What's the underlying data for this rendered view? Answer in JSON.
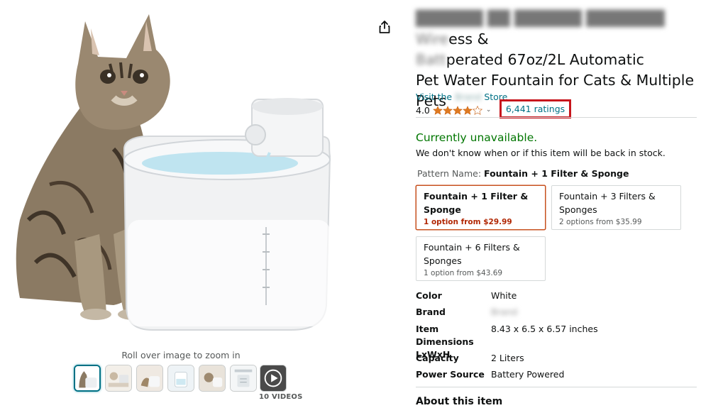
{
  "gallery": {
    "zoom_hint": "Roll over image to zoom in",
    "videos_label": "10 VIDEOS",
    "thumbnails": [
      "cat-and-fountain",
      "fountain-parts",
      "cat-drinking",
      "fountain-side",
      "cat-with-fountain",
      "fountain-diagram",
      "video-play"
    ]
  },
  "product": {
    "title_blurred_lead": "██████ ██ ██████ ███████",
    "title_blurred_word": "Wire",
    "title_visible_1": "ess &",
    "title_blur_2": "Batt",
    "title_visible_2": "perated 67oz/2L Automatic",
    "title_line_3": "Pet Water Fountain for Cats & Multiple",
    "title_line_4": "Pets",
    "store_prefix": "Visit the",
    "store_blurred": "Brand",
    "store_suffix": "Store",
    "rating_value": "4.0",
    "stars": 4.0,
    "ratings_count": "6,441 ratings",
    "availability": "Currently unavailable.",
    "stock_note": "We don't know when or if this item will be back in stock.",
    "pattern_label": "Pattern Name:",
    "pattern_selected": "Fountain + 1 Filter & Sponge",
    "options": [
      {
        "name": "Fountain + 1 Filter & Sponge",
        "price": "1 option from $29.99"
      },
      {
        "name": "Fountain + 3 Filters & Sponges",
        "price": "2 options from $35.99"
      },
      {
        "name": "Fountain + 6 Filters & Sponges",
        "price": "1 option from $43.69"
      }
    ],
    "specs": [
      {
        "key": "Color",
        "value": "White"
      },
      {
        "key": "Brand",
        "value": "Brand"
      },
      {
        "key": "Item Dimensions LxWxH",
        "value": "8.43 x 6.5 x 6.57 inches"
      },
      {
        "key": "Capacity",
        "value": "2 Liters"
      },
      {
        "key": "Power Source",
        "value": "Battery Powered"
      }
    ],
    "about_heading": "About this item"
  },
  "colors": {
    "link": "#007185",
    "available_green": "#007600",
    "price_red": "#b12704",
    "highlight_box": "#c7161d",
    "star_fill": "#de7921"
  }
}
